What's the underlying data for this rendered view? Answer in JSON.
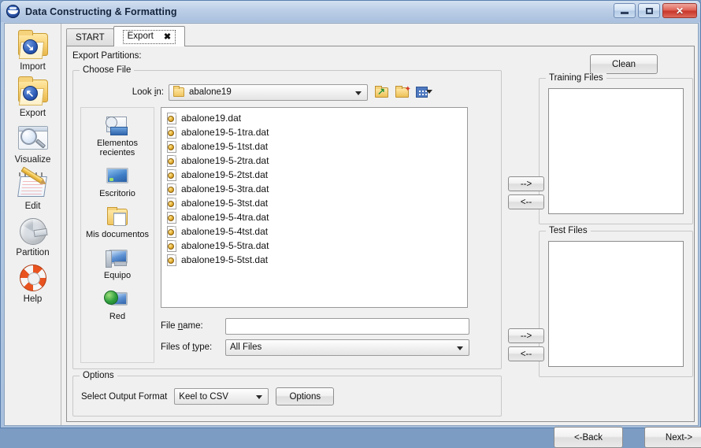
{
  "window": {
    "title": "Data Constructing & Formatting",
    "app_icon": "keel-logo-icon",
    "minimize_label": "",
    "maximize_label": "",
    "close_label": "✕"
  },
  "sidebar": {
    "items": [
      {
        "label": "Import",
        "icon": "import-folder-icon",
        "glyph": "↓"
      },
      {
        "label": "Export",
        "icon": "export-folder-icon",
        "glyph": "↖"
      },
      {
        "label": "Visualize",
        "icon": "magnifier-icon"
      },
      {
        "label": "Edit",
        "icon": "notebook-pencil-icon"
      },
      {
        "label": "Partition",
        "icon": "pie-chart-icon"
      },
      {
        "label": "Help",
        "icon": "lifebuoy-icon"
      }
    ]
  },
  "tabs": [
    {
      "label": "START",
      "active": false,
      "closable": false
    },
    {
      "label": "Export",
      "active": true,
      "closable": true,
      "close_glyph": "✖"
    }
  ],
  "main": {
    "export_partitions_label": "Export Partitions:",
    "choose_file": {
      "title": "Choose File",
      "look_in_label": "Look in:",
      "look_in_value": "abalone19",
      "toolbar": [
        {
          "icon": "up-one-level-icon"
        },
        {
          "icon": "create-new-folder-icon"
        },
        {
          "icon": "view-menu-icon"
        }
      ],
      "places": [
        {
          "label": "Elementos recientes",
          "icon": "recent-items-icon"
        },
        {
          "label": "Escritorio",
          "icon": "desktop-icon"
        },
        {
          "label": "Mis documentos",
          "icon": "my-documents-icon"
        },
        {
          "label": "Equipo",
          "icon": "computer-icon"
        },
        {
          "label": "Red",
          "icon": "network-icon"
        }
      ],
      "files": [
        "abalone19.dat",
        "abalone19-5-1tra.dat",
        "abalone19-5-1tst.dat",
        "abalone19-5-2tra.dat",
        "abalone19-5-2tst.dat",
        "abalone19-5-3tra.dat",
        "abalone19-5-3tst.dat",
        "abalone19-5-4tra.dat",
        "abalone19-5-4tst.dat",
        "abalone19-5-5tra.dat",
        "abalone19-5-5tst.dat"
      ],
      "file_name_label": "File name:",
      "file_name_value": "",
      "file_name_placeholder": "",
      "files_of_type_label": "Files of type:",
      "files_of_type_value": "All Files"
    },
    "options": {
      "title": "Options",
      "select_output_format_label": "Select Output Format",
      "output_format_value": "Keel to CSV",
      "options_button_label": "Options"
    }
  },
  "right_panel": {
    "clean_button_label": "Clean",
    "training_files": {
      "title": "Training Files",
      "items": []
    },
    "test_files": {
      "title": "Test Files",
      "items": []
    },
    "add_to_training_label": "-->",
    "remove_from_training_label": "<--",
    "add_to_test_label": "-->",
    "remove_from_test_label": "<--",
    "back_button_label": "<-Back",
    "next_button_label": "Next->"
  },
  "colors": {
    "titlebar_accent": "#a9c0dd",
    "close_button": "#c8362b",
    "panel_background": "#f0f0f0",
    "list_background": "#ffffff",
    "folder_yellow": "#f0c561",
    "buoy_orange": "#e8531f"
  }
}
